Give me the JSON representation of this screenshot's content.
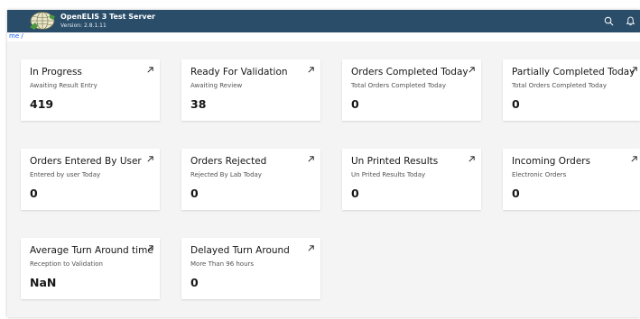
{
  "header": {
    "title": "OpenELIS 3 Test Server",
    "version": "Version:  2.8.1.11",
    "icons": [
      "logo-icon",
      "search-icon",
      "notification-bell-icon"
    ]
  },
  "breadcrumb": {
    "text": "me /"
  },
  "cards": [
    {
      "title": "In Progress",
      "subtitle": "Awaiting Result Entry",
      "count": "419"
    },
    {
      "title": "Ready For Validation",
      "subtitle": "Awaiting Review",
      "count": "38"
    },
    {
      "title": "Orders Completed Today",
      "subtitle": "Total Orders Completed Today",
      "count": "0"
    },
    {
      "title": "Partially Completed Today",
      "subtitle": "Total Orders Completed Today",
      "count": "0"
    },
    {
      "title": "Orders Entered By User",
      "subtitle": "Entered by user Today",
      "count": "0"
    },
    {
      "title": "Orders Rejected",
      "subtitle": "Rejected By Lab Today",
      "count": "0"
    },
    {
      "title": "Un Printed Results",
      "subtitle": "Un Prited Results Today",
      "count": "0"
    },
    {
      "title": "Incoming Orders",
      "subtitle": "Electronic Orders",
      "count": "0"
    },
    {
      "title": "Average Turn Around time",
      "subtitle": "Reception to Validation",
      "count": "NaN"
    },
    {
      "title": "Delayed Turn Around",
      "subtitle": "More Than 96 hours",
      "count": "0"
    }
  ],
  "colors": {
    "header_bg": "#2a4d69",
    "page_bg": "#f4f4f4",
    "card_bg": "#ffffff",
    "link": "#0f62fe"
  }
}
